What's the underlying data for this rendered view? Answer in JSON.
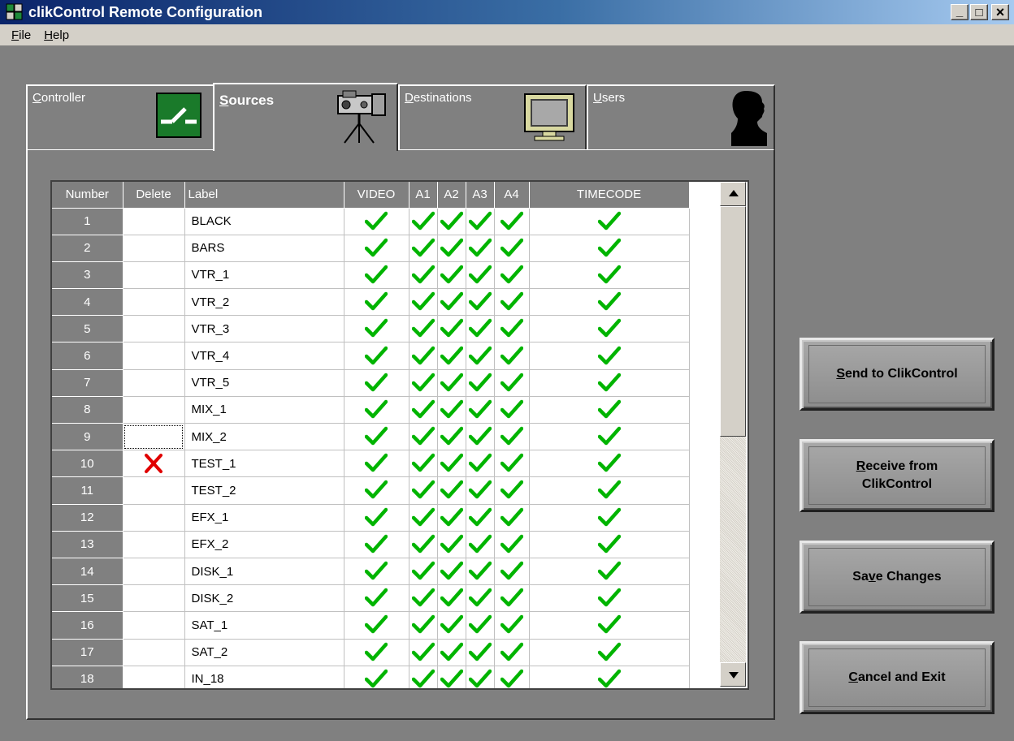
{
  "window": {
    "title": "clikControl Remote Configuration",
    "minimize_glyph": "_",
    "maximize_glyph": "□",
    "close_glyph": "×"
  },
  "menu": [
    {
      "pre": "",
      "ul": "F",
      "post": "ile"
    },
    {
      "pre": "",
      "ul": "H",
      "post": "elp"
    }
  ],
  "tabs": {
    "controller": {
      "pre": "",
      "ul": "C",
      "post": "ontroller"
    },
    "sources": {
      "pre": "",
      "ul": "S",
      "post": "ources"
    },
    "destinations": {
      "pre": "",
      "ul": "D",
      "post": "estinations"
    },
    "users": {
      "pre": "",
      "ul": "U",
      "post": "sers"
    }
  },
  "grid": {
    "headers": {
      "number": "Number",
      "delete": "Delete",
      "label": "Label",
      "video": "VIDEO",
      "a1": "A1",
      "a2": "A2",
      "a3": "A3",
      "a4": "A4",
      "timecode": "TIMECODE"
    },
    "rows": [
      {
        "number": "1",
        "label": "BLACK",
        "delete": false
      },
      {
        "number": "2",
        "label": "BARS",
        "delete": false
      },
      {
        "number": "3",
        "label": "VTR_1",
        "delete": false
      },
      {
        "number": "4",
        "label": "VTR_2",
        "delete": false
      },
      {
        "number": "5",
        "label": "VTR_3",
        "delete": false
      },
      {
        "number": "6",
        "label": "VTR_4",
        "delete": false
      },
      {
        "number": "7",
        "label": "VTR_5",
        "delete": false
      },
      {
        "number": "8",
        "label": "MIX_1",
        "delete": false
      },
      {
        "number": "9",
        "label": "MIX_2",
        "delete": false,
        "focused": true
      },
      {
        "number": "10",
        "label": "TEST_1",
        "delete": true
      },
      {
        "number": "11",
        "label": "TEST_2",
        "delete": false
      },
      {
        "number": "12",
        "label": "EFX_1",
        "delete": false
      },
      {
        "number": "13",
        "label": "EFX_2",
        "delete": false
      },
      {
        "number": "14",
        "label": "DISK_1",
        "delete": false
      },
      {
        "number": "15",
        "label": "DISK_2",
        "delete": false
      },
      {
        "number": "16",
        "label": "SAT_1",
        "delete": false
      },
      {
        "number": "17",
        "label": "SAT_2",
        "delete": false
      },
      {
        "number": "18",
        "label": "IN_18",
        "delete": false
      }
    ],
    "check_color": "#00b400",
    "delete_color": "#e00000"
  },
  "buttons": {
    "send": {
      "pre": "",
      "ul": "S",
      "post": "end to ClikControl"
    },
    "receive": {
      "pre": "",
      "ul": "R",
      "post": "eceive from",
      "line2": "ClikControl"
    },
    "save": {
      "pre": "Sa",
      "ul": "v",
      "post": "e Changes"
    },
    "cancel": {
      "pre": "",
      "ul": "C",
      "post": "ancel and Exit"
    }
  }
}
